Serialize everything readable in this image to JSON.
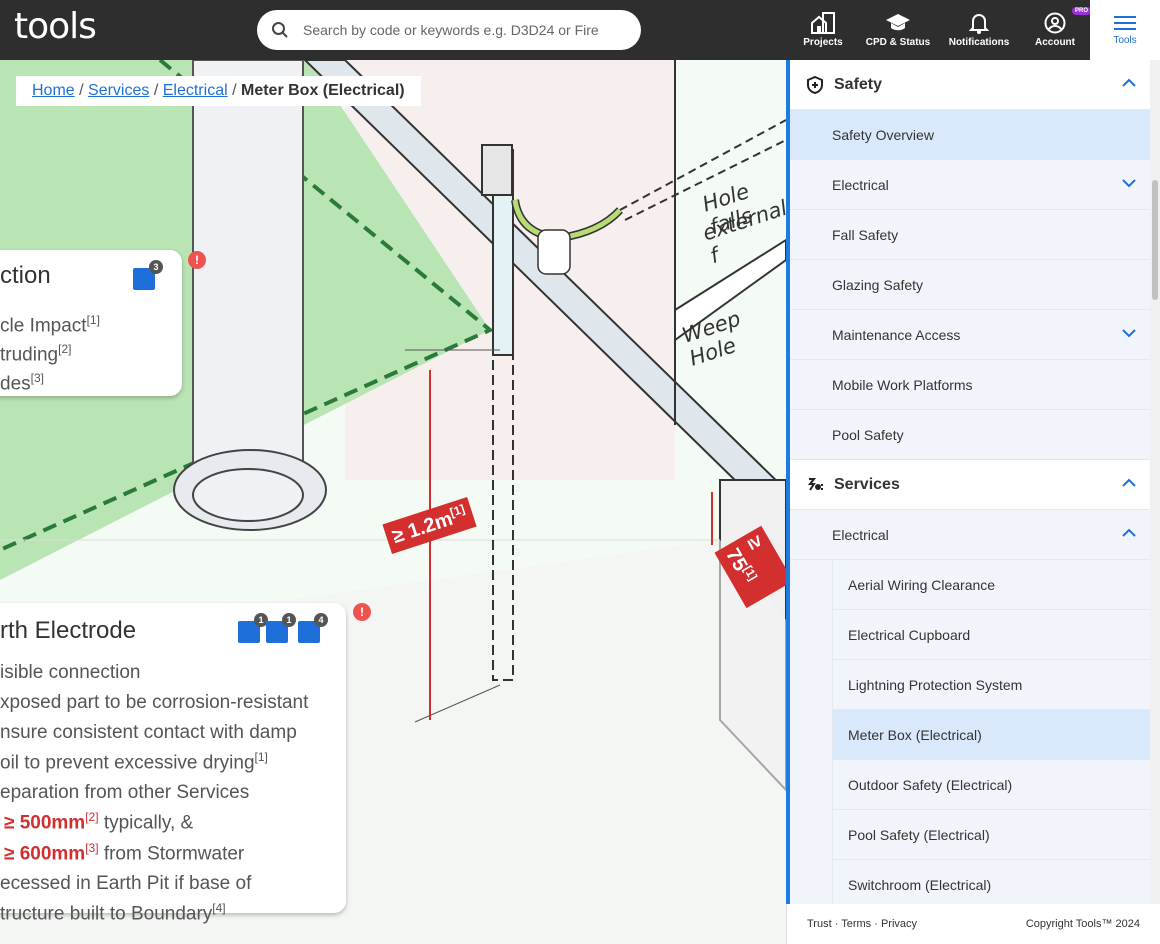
{
  "header": {
    "logo": "tools",
    "search_placeholder": "Search by code or keywords e.g. D3D24 or Fire",
    "nav": [
      {
        "label": "Projects",
        "icon": "buildings-icon"
      },
      {
        "label": "CPD & Status",
        "icon": "graduation-cap-icon"
      },
      {
        "label": "Notifications",
        "icon": "bell-icon"
      },
      {
        "label": "Account",
        "icon": "account-icon",
        "badge": "PRO"
      },
      {
        "label": "Tools",
        "icon": "menu-icon"
      }
    ]
  },
  "breadcrumb": {
    "items": [
      "Home",
      "Services",
      "Electrical"
    ],
    "current": "Meter Box (Electrical)",
    "separator": "/"
  },
  "illustration": {
    "dim1": "≥ 1.2m",
    "dim1_ref": "[1]",
    "dim2": "≥ 75",
    "dim2_ref": "[1]",
    "label_hole_1": "Hole falls",
    "label_hole_2": "external f",
    "label_weep": "Weep Hole",
    "colors": {
      "green": "#b9e4b4",
      "red": "#d32f2f",
      "wall": "#f7eeee"
    }
  },
  "card_protection": {
    "title": "ction",
    "badge_quotes": "3",
    "lines": [
      {
        "text": "cle Impact",
        "ref": "[1]"
      },
      {
        "text": "truding",
        "ref": "[2]"
      },
      {
        "text": "des",
        "ref": "[3]"
      }
    ]
  },
  "card_earth": {
    "title": "rth Electrode",
    "badge_calc": "1",
    "badge_image": "1",
    "badge_quotes": "4",
    "l1": "isible connection",
    "l2": "xposed part to be corrosion-resistant",
    "l3a": "nsure consistent contact with damp",
    "l3b": "oil to prevent excessive drying",
    "l3ref": "[1]",
    "l4": "eparation from other Services",
    "v1": "≥ 500mm",
    "v1ref": "[2]",
    "v1t": " typically, &",
    "v2": "≥ 600mm",
    "v2ref": "[3]",
    "v2t": " from Stormwater",
    "l5a": "ecessed in Earth Pit if base of",
    "l5b": "tructure built to Boundary",
    "l5ref": "[4]"
  },
  "sidebar": {
    "safety": {
      "label": "Safety",
      "items": [
        "Safety Overview",
        "Electrical",
        "Fall Safety",
        "Glazing Safety",
        "Maintenance Access",
        "Mobile Work Platforms",
        "Pool Safety"
      ]
    },
    "services": {
      "label": "Services",
      "sub": "Electrical",
      "items": [
        "Aerial Wiring Clearance",
        "Electrical Cupboard",
        "Lightning Protection System",
        "Meter Box (Electrical)",
        "Outdoor Safety (Electrical)",
        "Pool Safety (Electrical)",
        "Switchroom (Electrical)"
      ]
    }
  },
  "footer": {
    "trust": "Trust",
    "terms": "Terms",
    "privacy": "Privacy",
    "copyright": "Copyright Tools™ 2024"
  },
  "accent": "#1e7be0"
}
